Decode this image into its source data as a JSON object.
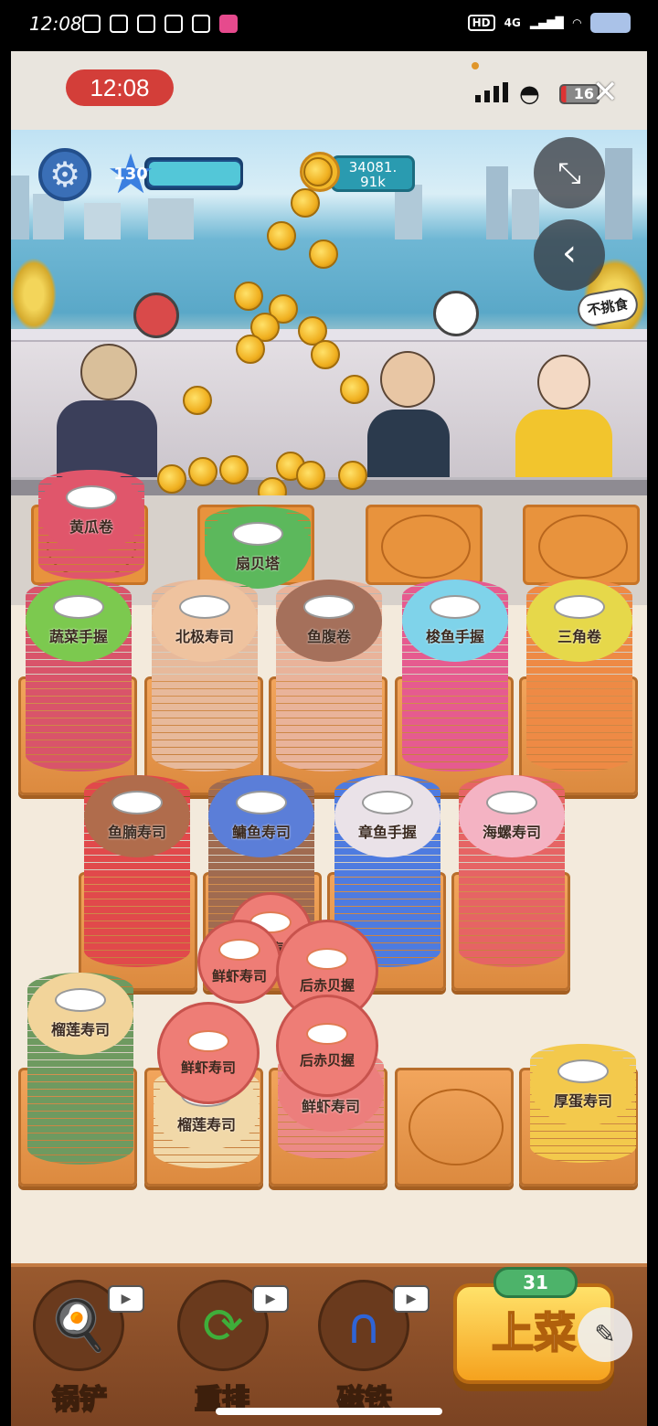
{
  "status_bar": {
    "time": "12:08",
    "hd": "HD",
    "network": "4G"
  },
  "top_bar": {
    "clock": "12:08",
    "battery": "16"
  },
  "hud": {
    "level": "130",
    "level_progress": 0.98,
    "coins": "34081.\n91k"
  },
  "scene": {
    "picky_tag": "不挑食",
    "customers": [
      {
        "name": "customer-left",
        "wants": "sushi-roll-icon"
      },
      {
        "name": "customer-middle",
        "wants": "nigiri-icon"
      },
      {
        "name": "customer-right-bunny",
        "wants": null
      }
    ]
  },
  "serve_slots": [
    {
      "label": "黄瓜卷",
      "filled": true,
      "color": "#e0566b"
    },
    {
      "label": "扇贝塔",
      "filled": true,
      "color": "#5cb85c"
    },
    {
      "label": "",
      "filled": false
    },
    {
      "label": "",
      "filled": false
    }
  ],
  "stacks_row1": [
    {
      "label": "蔬菜手握",
      "top_color": "#7cc94f",
      "body_color": "#d9546a"
    },
    {
      "label": "北极寿司",
      "top_color": "#efc39f",
      "body_color": "#e7b99b"
    },
    {
      "label": "鱼腹卷",
      "top_color": "#a5705b",
      "body_color": "#e9b39a"
    },
    {
      "label": "梭鱼手握",
      "top_color": "#7fd3ea",
      "body_color": "#e65b8f"
    },
    {
      "label": "三角卷",
      "top_color": "#e6d84a",
      "body_color": "#ee8a45"
    }
  ],
  "stacks_row2": [
    {
      "label": "鱼腩寿司",
      "top_color": "#b06c4c",
      "body_color": "#e1494b"
    },
    {
      "label": "鳙鱼寿司",
      "top_color": "#5b7ed8",
      "body_color": "#a06b50"
    },
    {
      "label": "章鱼手握",
      "top_color": "#eae2e8",
      "body_color": "#4e7be0"
    },
    {
      "label": "海螺寿司",
      "top_color": "#f4b3c3",
      "body_color": "#e66464"
    }
  ],
  "stacks_row3": [
    {
      "label": "榴莲寿司",
      "top_color": "#f2d49a",
      "body_color": "#6e9a60"
    },
    {
      "label": "榴莲寿司",
      "top_color": "#f1d8a8",
      "body_color": "#f1d8a8"
    },
    {
      "label": "鲜虾寿司",
      "top_color": "#ec7e7c",
      "body_color": "#ec8a86"
    },
    {
      "label": "",
      "top_color": "",
      "body_color": ""
    },
    {
      "label": "厚蛋寿司",
      "top_color": "#f3c94c",
      "body_color": "#f3c94c"
    }
  ],
  "flying_plates": [
    {
      "label": "鲜虾寿司"
    },
    {
      "label": "鲜虾寿司"
    },
    {
      "label": "鲜虾寿司"
    },
    {
      "label": "后赤贝握"
    },
    {
      "label": "后赤贝握"
    }
  ],
  "toolbar": {
    "spatula_label": "锅铲",
    "reshuffle_label": "重排",
    "magnet_label": "磁铁",
    "serve_label": "上菜",
    "serve_count": "31"
  }
}
